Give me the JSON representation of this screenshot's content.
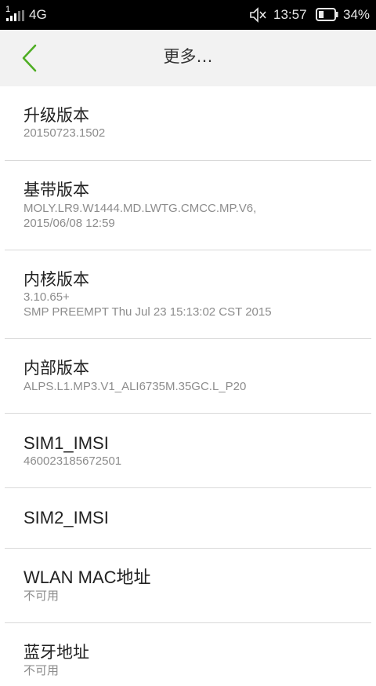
{
  "status_bar": {
    "sim_number": "1",
    "network": "4G",
    "time": "13:57",
    "battery": "34%",
    "battery_level": 0.34,
    "icons": [
      "signal-icon",
      "mute-icon",
      "battery-icon"
    ]
  },
  "header": {
    "title": "更多…",
    "back_icon": "chevron-left-icon",
    "accent_color": "#4fae24"
  },
  "items": [
    {
      "label": "升级版本",
      "value": "20150723.1502"
    },
    {
      "label": "基带版本",
      "value": "MOLY.LR9.W1444.MD.LWTG.CMCC.MP.V6,\n2015/06/08 12:59"
    },
    {
      "label": "内核版本",
      "value": "3.10.65+\nSMP PREEMPT Thu Jul 23 15:13:02 CST 2015"
    },
    {
      "label": "内部版本",
      "value": "ALPS.L1.MP3.V1_ALI6735M.35GC.L_P20"
    },
    {
      "label": "SIM1_IMSI",
      "value": "460023185672501"
    },
    {
      "label": "SIM2_IMSI",
      "value": ""
    },
    {
      "label": "WLAN MAC地址",
      "value": "不可用"
    },
    {
      "label": "蓝牙地址",
      "value": "不可用"
    }
  ]
}
